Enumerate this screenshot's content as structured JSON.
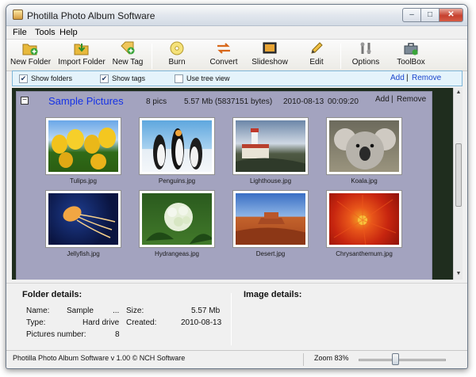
{
  "window": {
    "title": "Photilla Photo Album Software"
  },
  "menu": [
    "File",
    "Tools",
    "Help"
  ],
  "toolbar": {
    "new_folder": "New Folder",
    "import_folder": "Import Folder",
    "new_tag": "New Tag",
    "burn": "Burn",
    "convert": "Convert",
    "slideshow": "Slideshow",
    "edit": "Edit",
    "options": "Options",
    "toolbox": "ToolBox"
  },
  "options_bar": {
    "show_folders": "Show folders",
    "show_folders_checked": true,
    "show_tags": "Show tags",
    "show_tags_checked": true,
    "use_tree_view": "Use tree view",
    "use_tree_view_checked": false,
    "add": "Add",
    "sep": "|",
    "remove": "Remove"
  },
  "album": {
    "collapse_symbol": "−",
    "name": "Sample Pictures",
    "count": "8 pics",
    "size": "5.57 Mb (5837151 bytes)",
    "date": "2010-08-13",
    "time": "00:09:20",
    "add": "Add",
    "sep": "|",
    "remove": "Remove"
  },
  "photos": [
    {
      "file": "Tulips.jpg",
      "subject": "tulips"
    },
    {
      "file": "Penguins.jpg",
      "subject": "penguins"
    },
    {
      "file": "Lighthouse.jpg",
      "subject": "lighthouse"
    },
    {
      "file": "Koala.jpg",
      "subject": "koala"
    },
    {
      "file": "Jellyfish.jpg",
      "subject": "jellyfish"
    },
    {
      "file": "Hydrangeas.jpg",
      "subject": "hydrangeas"
    },
    {
      "file": "Desert.jpg",
      "subject": "desert"
    },
    {
      "file": "Chrysanthemum.jpg",
      "subject": "chrysanthemum"
    }
  ],
  "folder_details": {
    "heading": "Folder details:",
    "name_label": "Name:",
    "name_value": "Sample",
    "name_more": "...",
    "type_label": "Type:",
    "type_value": "Hard drive",
    "pictures_label": "Pictures number:",
    "pictures_value": "8",
    "size_label": "Size:",
    "size_value": "5.57 Mb",
    "created_label": "Created:",
    "created_value": "2010-08-13"
  },
  "image_details": {
    "heading": "Image details:"
  },
  "status": {
    "text": "Photilla Photo Album Software v 1.00 © NCH Software",
    "zoom_label": "Zoom 83%",
    "zoom_percent": 83
  },
  "colors": {
    "link": "#1a44cc",
    "album_title": "#1532e6",
    "gallery_bg": "#a3a3bf",
    "options_bar": "#e4f3fb"
  }
}
